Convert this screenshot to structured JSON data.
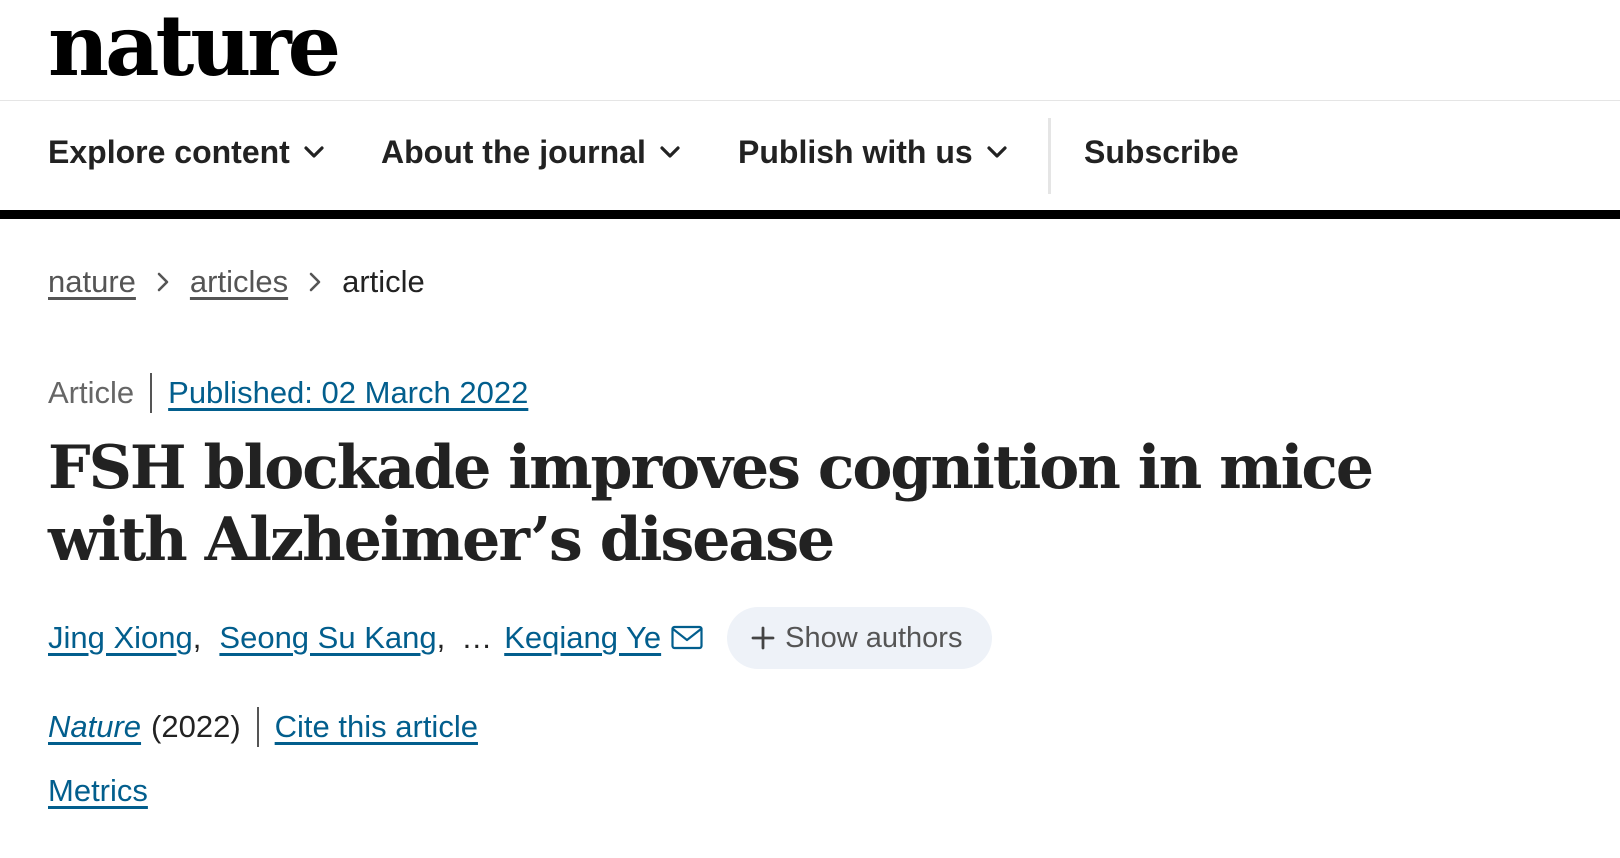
{
  "header": {
    "logo_text": "nature"
  },
  "nav": {
    "items": [
      {
        "label": "Explore content",
        "icon": "chevron-down-icon"
      },
      {
        "label": "About the journal",
        "icon": "chevron-down-icon"
      },
      {
        "label": "Publish with us",
        "icon": "chevron-down-icon"
      }
    ],
    "subscribe_label": "Subscribe"
  },
  "breadcrumb": {
    "items": [
      "nature",
      "articles"
    ],
    "current": "article",
    "separator_icon": "chevron-right-icon"
  },
  "article": {
    "type": "Article",
    "published": "Published: 02 March 2022",
    "title": "FSH blockade improves cognition in mice with Alzheimer’s disease",
    "authors": [
      "Jing Xiong",
      "Seong Su Kang",
      "Keqiang Ye"
    ],
    "author_separator": ",",
    "ellipsis": "…",
    "corresponding_icon": "mail-icon",
    "show_authors_label": "Show authors",
    "show_authors_icon": "plus-icon",
    "journal": "Nature",
    "year": "(2022)",
    "cite_label": "Cite this article",
    "metrics_label": "Metrics"
  },
  "colors": {
    "link": "#025e8d",
    "text": "#222222",
    "muted": "#666666",
    "nav_rule": "#000000",
    "pill_bg": "#eef2f8"
  }
}
